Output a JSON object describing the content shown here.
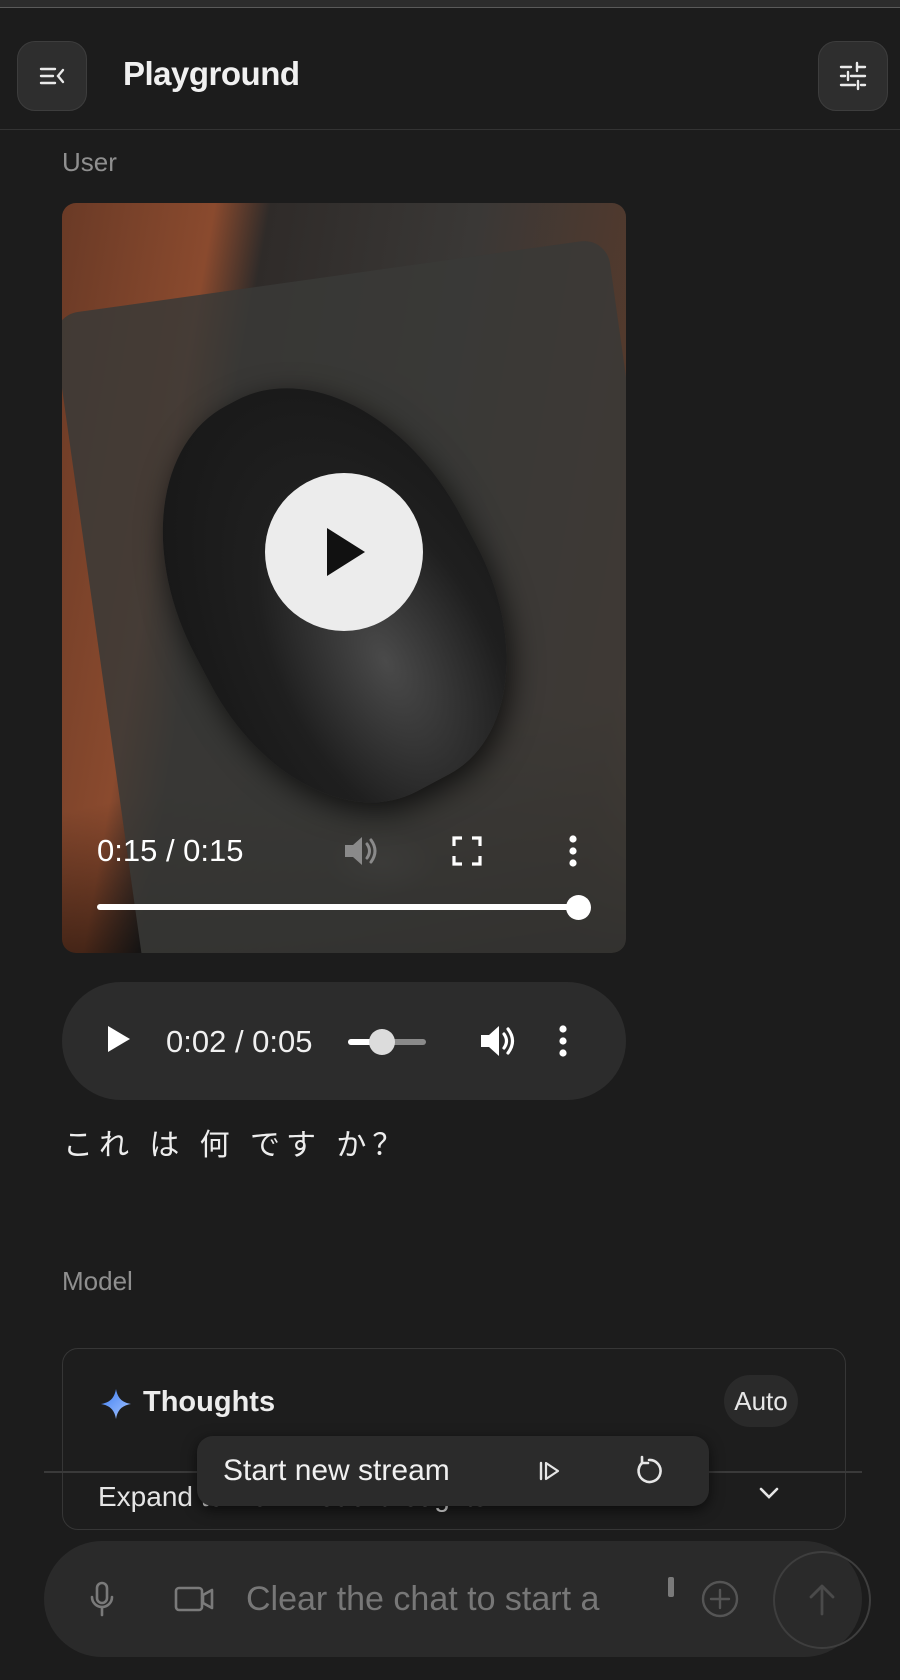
{
  "header": {
    "title": "Playground",
    "left_icon": "collapse-sidebar-icon",
    "right_icon": "tune-settings-icon"
  },
  "conversation": {
    "user_label": "User",
    "video": {
      "time": "0:15 / 0:15",
      "progress": 1.0
    },
    "audio": {
      "time": "0:02 / 0:05",
      "progress": 0.4
    },
    "user_message": "これ は 何 です か？",
    "model_label": "Model",
    "thoughts": {
      "title": "Thoughts",
      "mode": "Auto",
      "expand_text": "Expand to view model thoughts"
    }
  },
  "toast": {
    "label": "Start new stream"
  },
  "composer": {
    "placeholder": "Clear the chat to start a"
  },
  "colors": {
    "background": "#1c1c1c",
    "spark_start": "#4a8cf7",
    "spark_end": "#8fb7ff"
  }
}
